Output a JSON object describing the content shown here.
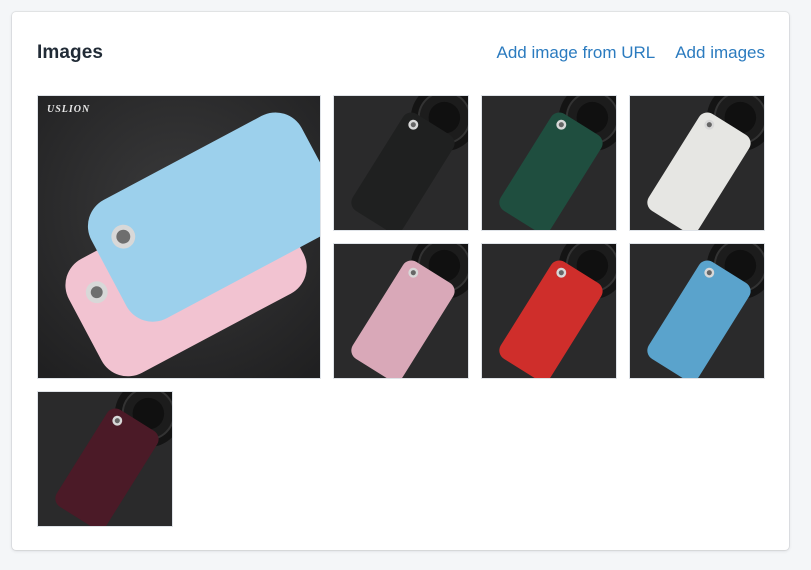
{
  "card": {
    "title": "Images",
    "add_from_url_label": "Add image from URL",
    "add_images_label": "Add images"
  },
  "images": {
    "featured": {
      "brand_text": "USLION",
      "colors": [
        "#9cd0ec",
        "#f2c3d1"
      ]
    },
    "items": [
      {
        "color": "#1f2020"
      },
      {
        "color": "#1f4e3f"
      },
      {
        "color": "#e6e6e3"
      },
      {
        "color": "#d9a8b8"
      },
      {
        "color": "#cf2e2b"
      },
      {
        "color": "#5aa3cc"
      },
      {
        "color": "#4b1a27"
      }
    ]
  }
}
